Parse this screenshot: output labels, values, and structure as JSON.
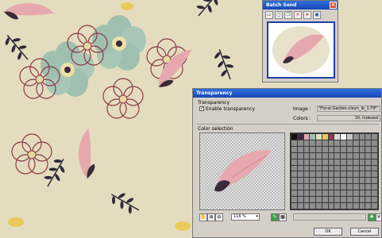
{
  "batch": {
    "title": "Batch Send",
    "toolbar_icons": [
      "open-folder-icon",
      "page-icon",
      "copy-icon",
      "delete-icon",
      "send-icon",
      "save-icon"
    ]
  },
  "transparency": {
    "title": "Transparency",
    "section_transparency": "Transparency",
    "enable_label": "Enable transparency",
    "image_label": "Image :",
    "image_value": "\"Floral Garden-cleyn_lb_1.TIF\"",
    "colors_label": "Colors :",
    "colors_value": "10, Indexed",
    "section_color": "Color selection",
    "zoom_value": "116 %",
    "ok_label": "OK",
    "cancel_label": "Cancel"
  },
  "colors": {
    "title_bar": "#1846b8",
    "background_pattern": "#e4dcbe"
  }
}
